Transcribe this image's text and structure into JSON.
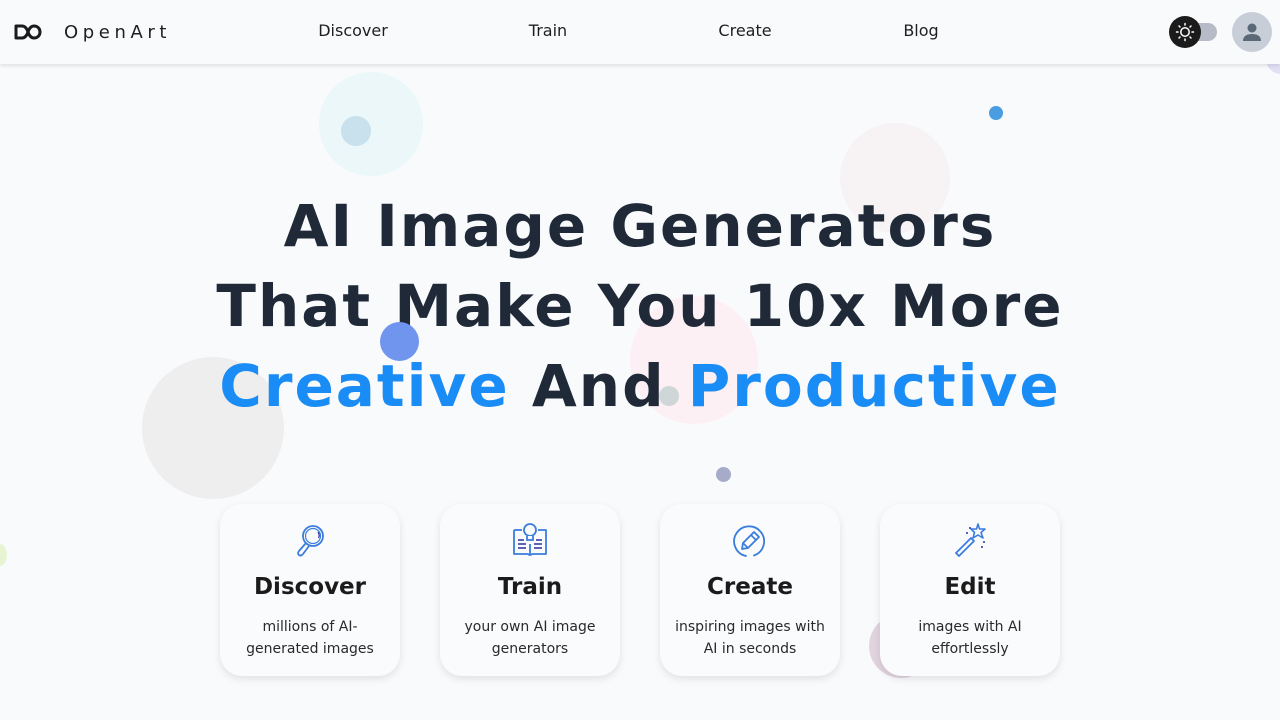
{
  "header": {
    "brand": "OpenArt",
    "nav": [
      {
        "label": "Discover"
      },
      {
        "label": "Train"
      },
      {
        "label": "Create"
      },
      {
        "label": "Blog"
      }
    ],
    "theme_toggle": {
      "mode": "light",
      "icon": "sun-icon"
    },
    "avatar_icon": "user-icon"
  },
  "hero": {
    "line1": "AI Image Generators",
    "line2": "That Make You 10x More",
    "line3_accent1": "Creative",
    "line3_mid": "And",
    "line3_accent2": "Productive"
  },
  "cards": [
    {
      "title": "Discover",
      "desc": "millions of AI-generated images",
      "icon": "magnifier-icon"
    },
    {
      "title": "Train",
      "desc": "your own AI image generators",
      "icon": "book-lightbulb-icon"
    },
    {
      "title": "Create",
      "desc": "inspiring images with AI in seconds",
      "icon": "pencil-circle-icon"
    },
    {
      "title": "Edit",
      "desc": "images with AI effortlessly",
      "icon": "magic-wand-icon"
    }
  ],
  "colors": {
    "accent": "#1a8cf5",
    "heading": "#1f2937",
    "background": "#f9fafc",
    "icon": "#3b7ddd"
  }
}
